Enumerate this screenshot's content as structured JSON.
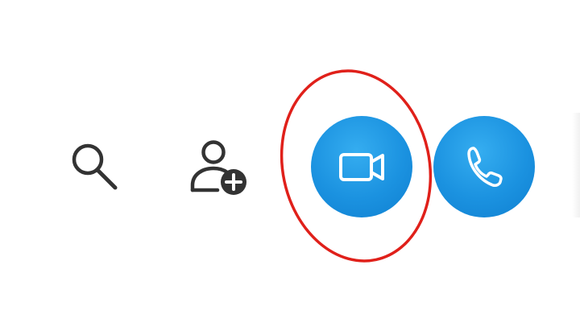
{
  "toolbar": {
    "buttons": [
      {
        "id": "search",
        "icon": "search-icon",
        "label": ""
      },
      {
        "id": "add-contact",
        "icon": "add-person-icon",
        "label": ""
      },
      {
        "id": "video-call",
        "icon": "video-camera-icon",
        "label": "",
        "color": "#1b92e0"
      },
      {
        "id": "audio-call",
        "icon": "phone-icon",
        "label": "",
        "color": "#1b92e0"
      }
    ]
  },
  "annotation": {
    "shape": "ellipse",
    "color": "#e0201a",
    "target": "video-call"
  },
  "colors": {
    "background": "#ffffff",
    "icon_dark": "#333333",
    "call_button": "#1b92e0",
    "icon_light": "#ffffff"
  }
}
